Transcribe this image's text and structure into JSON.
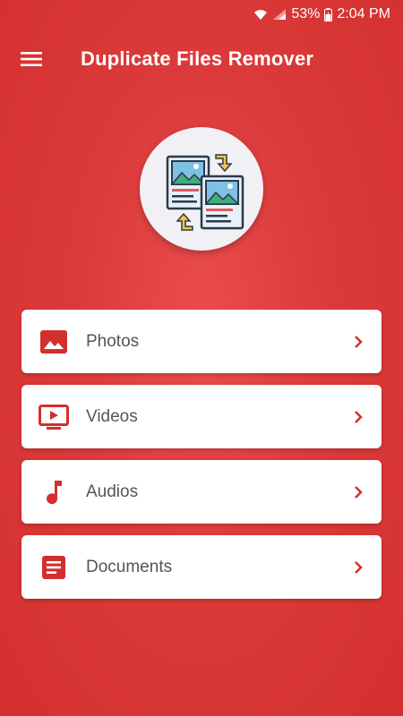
{
  "status_bar": {
    "battery": "53%",
    "time": "2:04 PM"
  },
  "app_bar": {
    "title": "Duplicate Files Remover",
    "menu_icon": "menu-icon"
  },
  "logo": {
    "icon": "duplicate-images-swap-icon"
  },
  "categories": [
    {
      "label": "Photos",
      "icon": "image-icon"
    },
    {
      "label": "Videos",
      "icon": "video-icon"
    },
    {
      "label": "Audios",
      "icon": "music-note-icon"
    },
    {
      "label": "Documents",
      "icon": "document-icon"
    }
  ],
  "colors": {
    "primary": "#d32f2f",
    "icon_red": "#d32f2f",
    "card_bg": "#ffffff"
  }
}
